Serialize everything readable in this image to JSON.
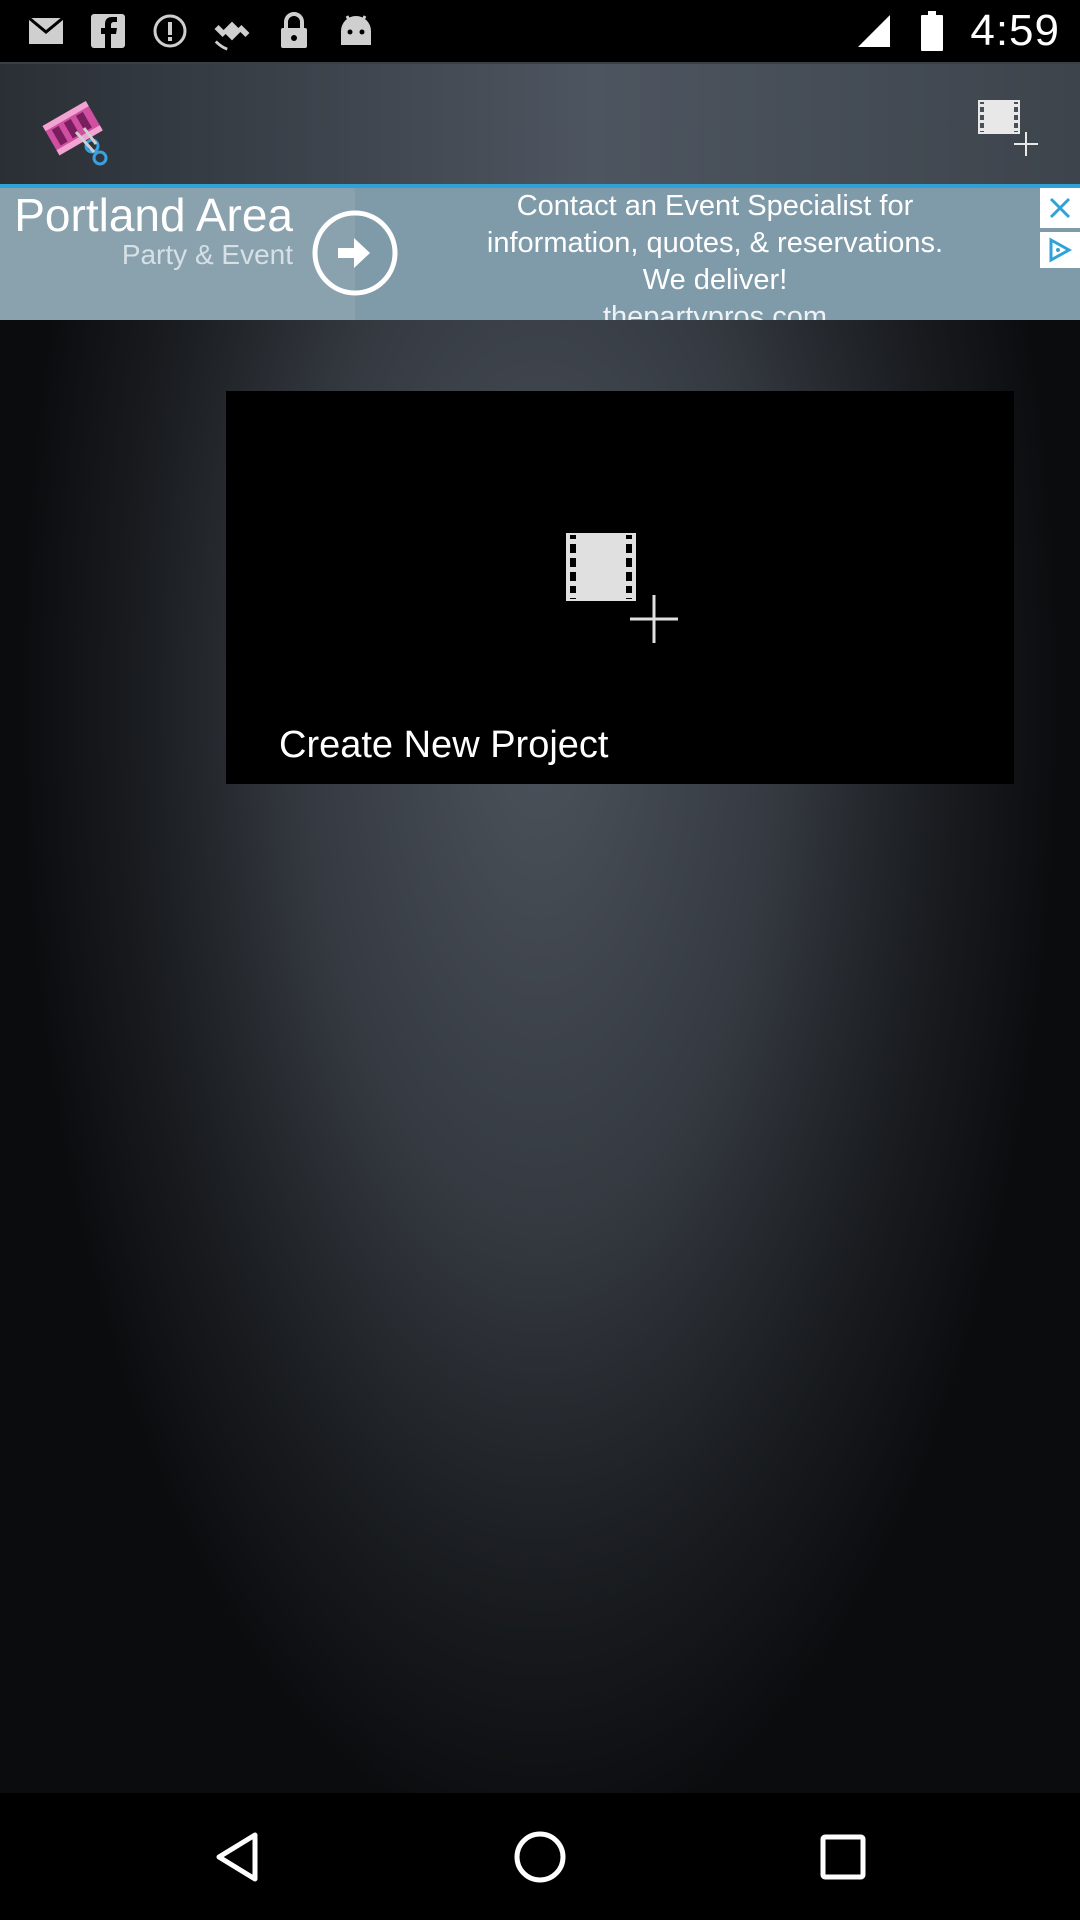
{
  "status_bar": {
    "time": "4:59",
    "left_icons": [
      "email-icon",
      "facebook-icon",
      "alert-icon",
      "fake-gps-icon",
      "lock-icon",
      "android-icon"
    ],
    "right_icons": [
      "signal-icon",
      "battery-icon"
    ]
  },
  "app_bar": {
    "logo_icon": "video-editor-logo-icon",
    "action_icon": "new-film-icon"
  },
  "ad": {
    "title": "Portland Area",
    "subtitle": "Party & Event",
    "line1": "Contact an Event Specialist for",
    "line2": "information, quotes, & reservations.",
    "line3": "We deliver!",
    "domain": "thepartypros.com",
    "close_icon": "close-icon",
    "adchoices_icon": "adchoices-icon"
  },
  "card": {
    "label": "Create New Project",
    "icon": "new-film-icon"
  },
  "nav": {
    "back_icon": "back-icon",
    "home_icon": "home-icon",
    "recents_icon": "recents-icon"
  },
  "colors": {
    "ad_accent": "#2fa3d8",
    "ad_background": "#7f9aa8"
  }
}
